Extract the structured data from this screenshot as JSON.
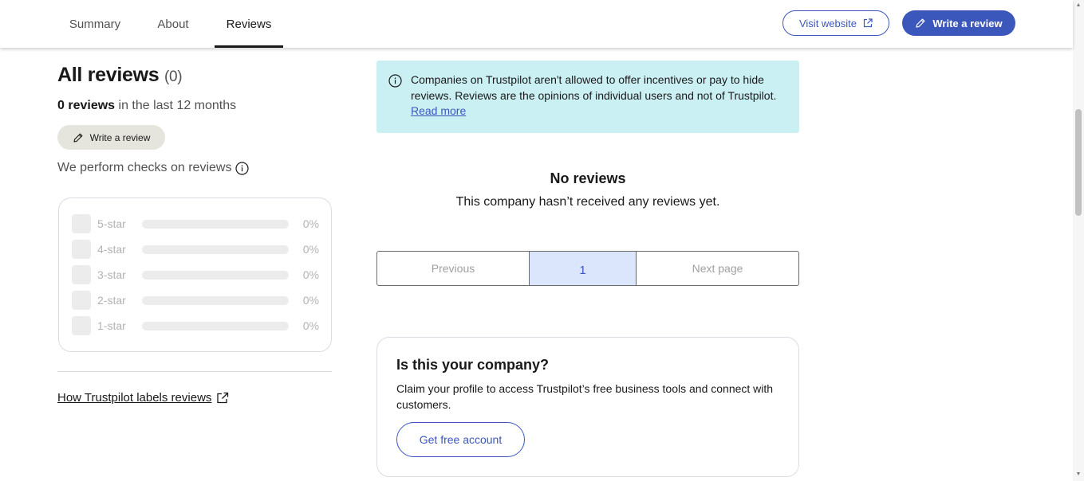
{
  "nav": {
    "tabs": [
      {
        "label": "Summary",
        "active": false
      },
      {
        "label": "About",
        "active": false
      },
      {
        "label": "Reviews",
        "active": true
      }
    ],
    "visit_website_label": "Visit website",
    "write_review_label": "Write a review"
  },
  "reviews": {
    "title": "All reviews",
    "count": "(0)",
    "subtitle_bold": "0 reviews",
    "subtitle_rest": " in the last 12 months",
    "write_review_label": "Write a review",
    "checks_label": "We perform checks on reviews",
    "distribution": [
      {
        "label": "5-star",
        "percent": "0%"
      },
      {
        "label": "4-star",
        "percent": "0%"
      },
      {
        "label": "3-star",
        "percent": "0%"
      },
      {
        "label": "2-star",
        "percent": "0%"
      },
      {
        "label": "1-star",
        "percent": "0%"
      }
    ],
    "labels_link": "How Trustpilot labels reviews"
  },
  "notice": {
    "text": "Companies on Trustpilot aren't allowed to offer incentives or pay to hide reviews. Reviews are the opinions of individual users and not of Trustpilot.",
    "link": "Read more"
  },
  "empty_state": {
    "title": "No reviews",
    "message": "This company hasn’t received any reviews yet."
  },
  "pagination": {
    "previous": "Previous",
    "current_page": "1",
    "next": "Next page"
  },
  "claim": {
    "title": "Is this your company?",
    "text": "Claim your profile to access Trustpilot’s free business tools and connect with customers.",
    "button": "Get free account"
  },
  "colors": {
    "accent": "#3c57bc",
    "notice_bg": "#cbf0f4",
    "active_page_bg": "#dbe5fb"
  },
  "icons": [
    "external-link-icon",
    "pencil-icon",
    "info-icon",
    "scroll-up-arrow-icon",
    "scroll-down-arrow-icon"
  ]
}
